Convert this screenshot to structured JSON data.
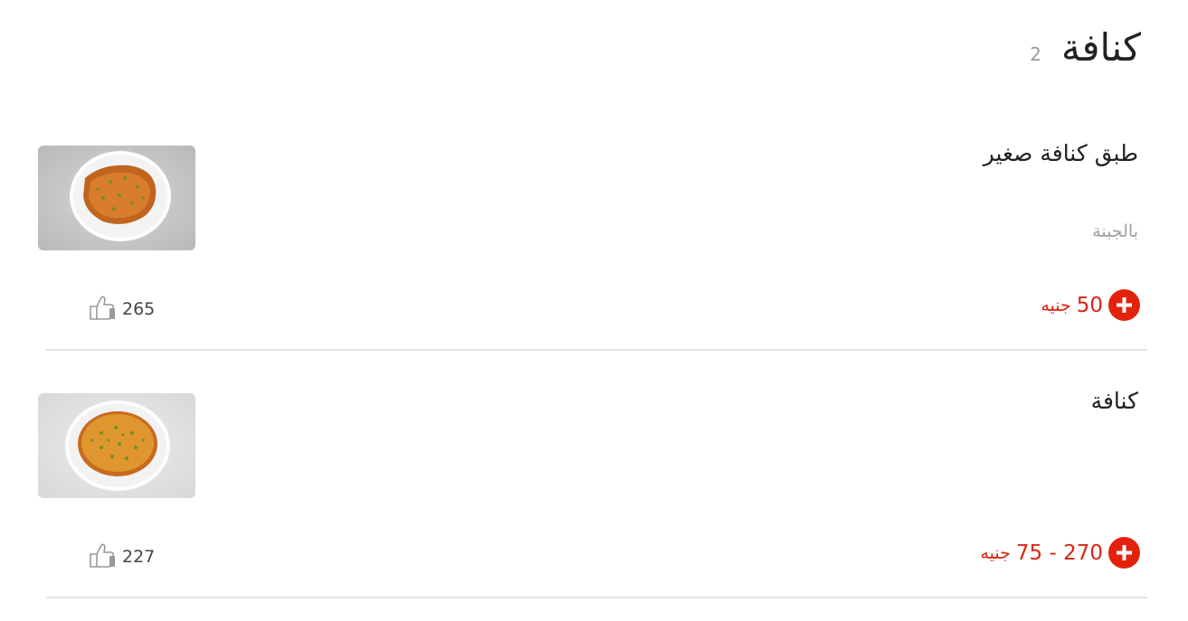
{
  "section": {
    "title": "كنافة",
    "count": "2"
  },
  "items": [
    {
      "name": "طبق كنافة صغير",
      "description": "بالجبنة",
      "price": "50",
      "currency": "جنيه",
      "likes": "265",
      "image_icon": "kunafa-plate-photo"
    },
    {
      "name": "كنافة",
      "description": "",
      "price": "75 - 270",
      "currency": "جنيه",
      "likes": "227",
      "image_icon": "kunafa-round-photo"
    }
  ],
  "colors": {
    "accent": "#e2220c",
    "price": "#d8260f",
    "muted": "#a0a0a0",
    "divider": "#e3e3e3"
  },
  "icons": {
    "add": "plus-circle-icon",
    "like": "thumbs-up-icon"
  }
}
